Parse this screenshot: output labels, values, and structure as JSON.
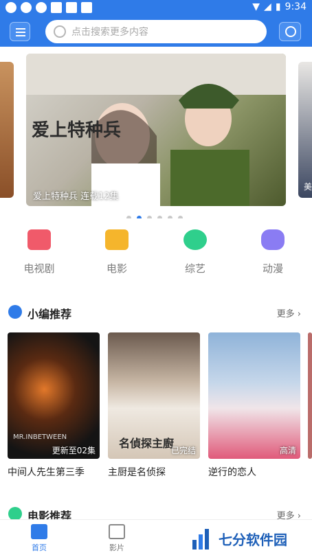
{
  "status_bar": {
    "time": "9:34"
  },
  "search": {
    "placeholder": "点击搜索更多内容"
  },
  "carousel": {
    "main_caption": "爱上特种兵 连载12集",
    "main_art_title": "爱上特种兵",
    "right_caption": "美",
    "dot_count": 6,
    "active_dot": 1
  },
  "categories": [
    {
      "label": "电视剧",
      "icon": "tv-icon",
      "color": "#f05a6a"
    },
    {
      "label": "电影",
      "icon": "film-icon",
      "color": "#f5b52c"
    },
    {
      "label": "综艺",
      "icon": "star-icon",
      "color": "#2fcf8c"
    },
    {
      "label": "动漫",
      "icon": "bear-icon",
      "color": "#8a7cf3"
    }
  ],
  "editor_picks": {
    "title": "小编推荐",
    "more": "更多",
    "items": [
      {
        "name": "中间人先生第三季",
        "tag": "更新至02集",
        "poster_label": "MR.INBETWEEN"
      },
      {
        "name": "主厨是名侦探",
        "tag": "已完结",
        "poster_label": "名偵探主廚"
      },
      {
        "name": "逆行的恋人",
        "tag": "高清",
        "poster_label": ""
      }
    ]
  },
  "movie_picks": {
    "title": "电影推荐",
    "more": "更多"
  },
  "tabbar": {
    "home": "首页",
    "film": "影片"
  },
  "watermark": {
    "text": "七分软件园"
  },
  "colors": {
    "accent": "#2f7be8"
  }
}
